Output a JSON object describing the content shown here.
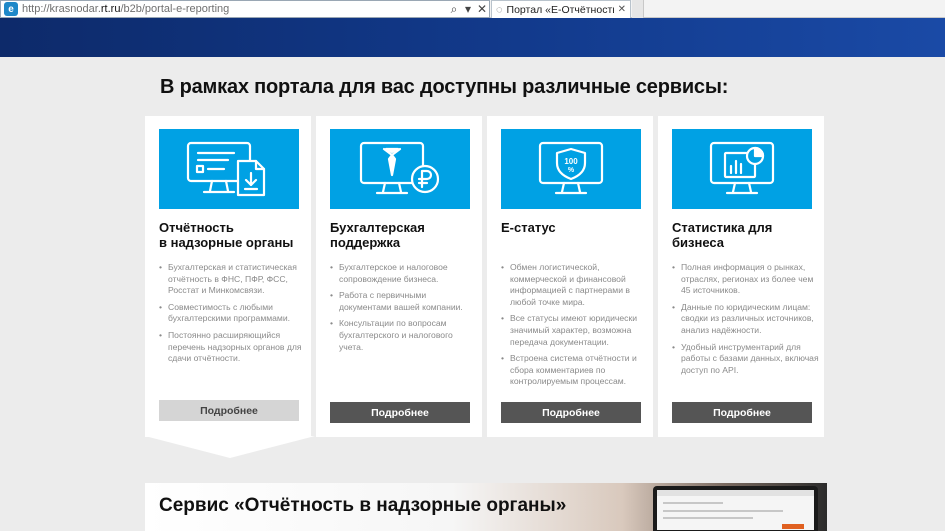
{
  "browser": {
    "url_prefix": "http://krasnodar.",
    "url_domain": "rt.ru",
    "url_path": "/b2b/portal-e-reporting",
    "tab_title": "Портал «Е-Отчётность» - ...",
    "site_icon_letter": "e",
    "search_glyph": "⌕",
    "dropdown_glyph": "▾",
    "close_glyph": "✕",
    "spinner_glyph": "◌",
    "tab_close_glyph": "✕"
  },
  "colors": {
    "header_start": "#0d2a6a",
    "header_end": "#1a4aa6",
    "banner": "#00a1e4",
    "button_dark": "#555555",
    "button_active": "#d5d5d5"
  },
  "heading": "В рамках портала для вас доступны различные сервисы:",
  "cards": [
    {
      "title_line1": "Отчётность",
      "title_line2": "в надзорные органы",
      "icon": "monitor-document-icon",
      "bullets": [
        "Бухгалтерская и статистическая отчётность в ФНС, ПФР, ФСС, Росстат и Минкомсвязи.",
        "Совместимость с любыми бухгалтерскими программами.",
        "Постоянно расширяющийся перечень надзорных органов для сдачи отчётности."
      ],
      "button": "Подробнее"
    },
    {
      "title_line1": "Бухгалтерская",
      "title_line2": "поддержка",
      "icon": "monitor-accountant-ruble-icon",
      "bullets": [
        "Бухгалтерское и налоговое сопровождение бизнеса.",
        "Работа с первичными документами вашей компании.",
        "Консультации по вопросам бухгалтерского и налогового учета."
      ],
      "button": "Подробнее"
    },
    {
      "title_line1": "Е-статус",
      "title_line2": "",
      "icon": "monitor-shield-100-icon",
      "shield_text_top": "100",
      "shield_text_bottom": "%",
      "bullets": [
        "Обмен логистической, коммерческой и финансовой информацией с партнерами в любой точке мира.",
        "Все статусы имеют юридически значимый характер, возможна передача документации.",
        "Встроена система отчётности и сбора комментариев по контролируемым процессам."
      ],
      "button": "Подробнее"
    },
    {
      "title_line1": "Статистика для",
      "title_line2": "бизнеса",
      "icon": "monitor-statistics-icon",
      "bullets": [
        "Полная информация о рынках, отраслях, регионах из более чем 45 источников.",
        "Данные по юридическим лицам: сводки из различных источников, анализ надёжности.",
        "Удобный инструментарий для работы с базами данных, включая доступ по API."
      ],
      "button": "Подробнее"
    }
  ],
  "promo": {
    "title": "Сервис «Отчётность в надзорные органы»"
  }
}
